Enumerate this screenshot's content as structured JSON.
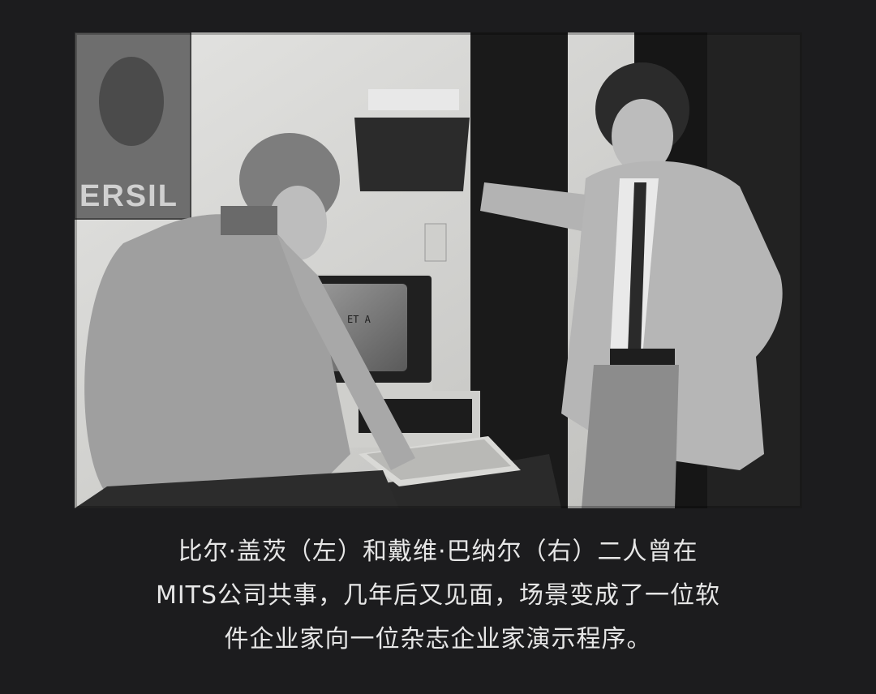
{
  "photo": {
    "poster_text": "ERSIL",
    "screen_text": "ET A",
    "colors": {
      "wall": "#d6d6d3",
      "door": "#161616",
      "background": "#1c1c1e"
    }
  },
  "caption": {
    "lines": [
      "比尔·盖茨（左）和戴维·巴纳尔（右）二人曾在",
      "MITS公司共事，几年后又见面，场景变成了一位软",
      "件企业家向一位杂志企业家演示程序。"
    ],
    "color": "#e6e6e6"
  }
}
